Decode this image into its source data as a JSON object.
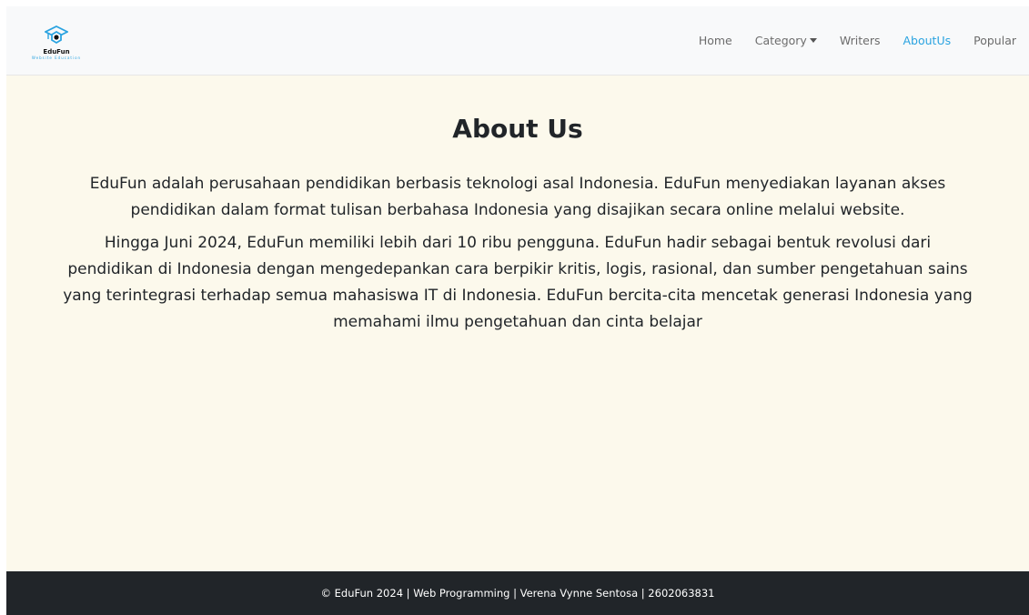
{
  "brand": {
    "name": "EduFun",
    "tagline": "Website Education",
    "logo_icon": "graduation-cap-hexagon-icon",
    "accent_color": "#2aa3e0"
  },
  "nav": {
    "items": [
      {
        "label": "Home",
        "active": false
      },
      {
        "label": "Category",
        "active": false,
        "dropdown": true
      },
      {
        "label": "Writers",
        "active": false
      },
      {
        "label": "AboutUs",
        "active": true
      },
      {
        "label": "Popular",
        "active": false
      }
    ]
  },
  "main": {
    "title": "About Us",
    "paragraphs": [
      "EduFun adalah perusahaan pendidikan berbasis teknologi asal Indonesia. EduFun menyediakan layanan akses pendidikan dalam format tulisan berbahasa Indonesia yang disajikan secara online melalui website.",
      "Hingga Juni 2024, EduFun memiliki lebih dari 10 ribu pengguna. EduFun hadir sebagai bentuk revolusi dari pendidikan di Indonesia dengan mengedepankan cara berpikir kritis, logis, rasional, dan sumber pengetahuan sains yang terintegrasi terhadap semua mahasiswa IT di Indonesia. EduFun bercita-cita mencetak generasi Indonesia yang memahami ilmu pengetahuan dan cinta belajar"
    ],
    "background_color": "#fcf9ec"
  },
  "footer": {
    "text": "© EduFun 2024 | Web Programming | Verena Vynne Sentosa | 2602063831",
    "background_color": "#212529"
  }
}
